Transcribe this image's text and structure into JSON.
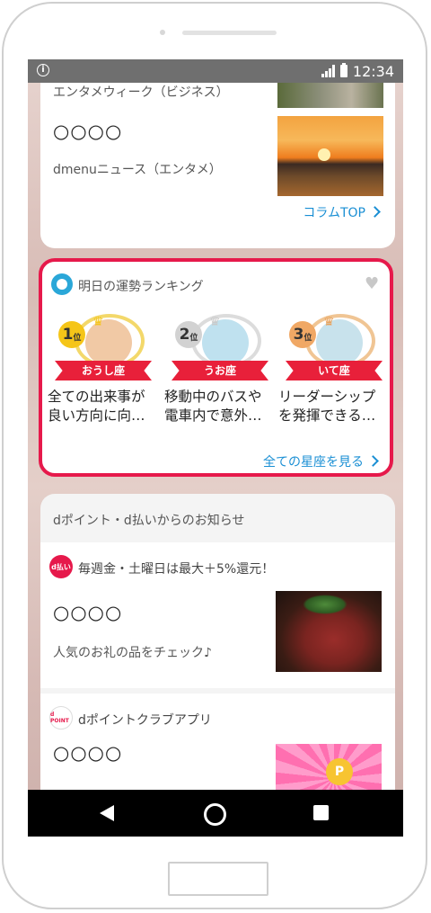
{
  "status_bar": {
    "time": "12:34",
    "info_icon": "info-icon"
  },
  "column_card": {
    "subtitle": "エンタメウィーク（ビジネス）",
    "headline": "○○○○",
    "source": "dmenuニュース（エンタメ）",
    "link": "コラムTOP"
  },
  "fortune": {
    "title": "明日の運勢ランキング",
    "ranks": [
      {
        "rank": "1",
        "suffix": "位",
        "sign": "おうし座",
        "line1": "全ての出来事が",
        "line2": "良い方向に向…",
        "accent": "#f5c518"
      },
      {
        "rank": "2",
        "suffix": "位",
        "sign": "うお座",
        "line1": "移動中のバスや",
        "line2": "電車内で意外…",
        "accent": "#c9c9c9"
      },
      {
        "rank": "3",
        "suffix": "位",
        "sign": "いて座",
        "line1": "リーダーシップ",
        "line2": "を発揮できる…",
        "accent": "#e9a15a"
      }
    ],
    "link": "全ての星座を見る"
  },
  "notices": {
    "header": "dポイント・d払いからのお知らせ",
    "items": [
      {
        "logo_text": "d払い",
        "title": "毎週金・土曜日は最大＋5%還元！",
        "headline": "○○○○",
        "text": "人気のお礼の品をチェック♪"
      },
      {
        "logo_text": "d POINT",
        "title": "dポイントクラブアプリ",
        "headline": "○○○○"
      }
    ]
  },
  "colors": {
    "accent_red": "#e6194b",
    "link_blue": "#1a8fd4",
    "status_gray": "#6f6f6f"
  }
}
